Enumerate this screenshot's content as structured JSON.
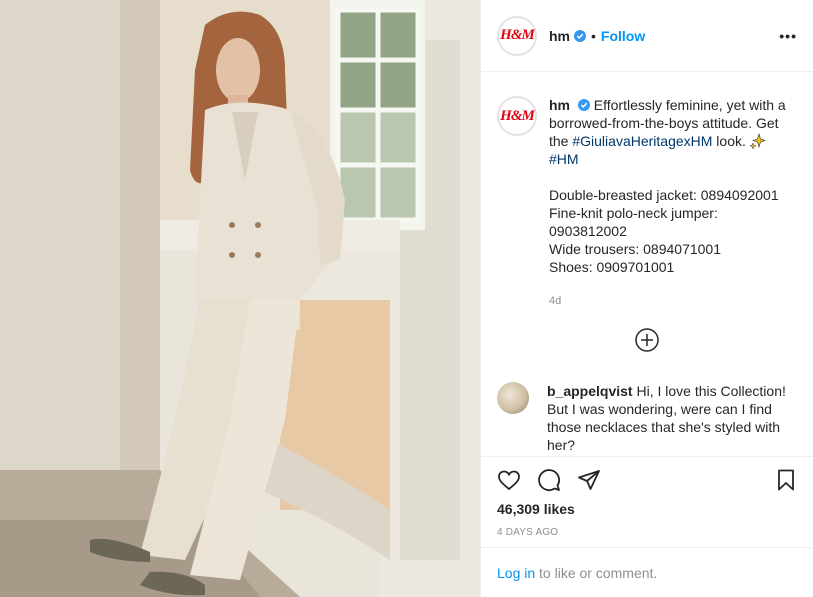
{
  "post": {
    "photo_alt": "Model in cream double-breasted suit leaning against a window",
    "colors": {
      "accent": "#0095f6",
      "brand": "#e50010",
      "hashtag": "#00376b",
      "muted": "#8e8e8e"
    }
  },
  "header": {
    "logo_text": "H&M",
    "username": "hm",
    "dot": "•",
    "follow_label": "Follow",
    "more_label": "•••"
  },
  "caption": {
    "username": "hm",
    "text_1": "Effortlessly feminine, yet with a borrowed-from-the-boys attitude. Get the ",
    "hashtag_1": "#GiuliavaHeritagexHM",
    "text_2": " look. ",
    "hashtag_2": "#HM",
    "items": [
      "Double-breasted jacket: 0894092001",
      "Fine-knit polo-neck jumper: 0903812002",
      "Wide trousers: 0894071001",
      "Shoes: 0909701001"
    ],
    "age": "4d"
  },
  "comment": {
    "username": "b_appelqvist",
    "text": "Hi, I love this Collection! But I was wondering, were can I find those necklaces that she's styled with her?"
  },
  "actions": {
    "icons": [
      "heart-icon",
      "comment-icon",
      "share-icon",
      "bookmark-icon"
    ],
    "likes": "46,309 likes",
    "date": "4 DAYS AGO"
  },
  "login": {
    "link_label": "Log in",
    "rest": " to like or comment."
  }
}
